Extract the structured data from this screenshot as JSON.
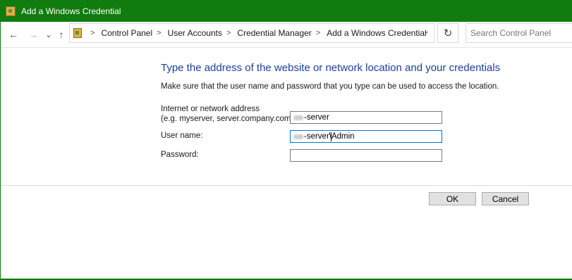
{
  "window": {
    "title": "Add a Windows Credential"
  },
  "nav": {
    "back_icon": "←",
    "forward_icon": "→",
    "recent_icon": "⌄",
    "up_icon": "↑"
  },
  "breadcrumb": {
    "items": [
      "Control Panel",
      "User Accounts",
      "Credential Manager",
      "Add a Windows Credential"
    ],
    "separator": ">",
    "dropdown_icon": "⌄",
    "refresh_icon": "↻"
  },
  "search": {
    "placeholder": "Search Control Panel",
    "value": ""
  },
  "form": {
    "heading": "Type the address of the website or network location and your credentials",
    "instructions": "Make sure that the user name and password that you type can be used to access the location.",
    "address_label_line1": "Internet or network address",
    "address_label_line2": "(e.g. myserver, server.company.com):",
    "address_value": "-server",
    "username_label": "User name:",
    "username_value_before_caret": "-server\\",
    "username_value_after_caret": "Admin",
    "password_label": "Password:"
  },
  "buttons": {
    "ok": "OK",
    "cancel": "Cancel"
  },
  "colors": {
    "titlebar": "#107c10",
    "heading": "#1e3f9a",
    "focus_border": "#0078d7"
  }
}
